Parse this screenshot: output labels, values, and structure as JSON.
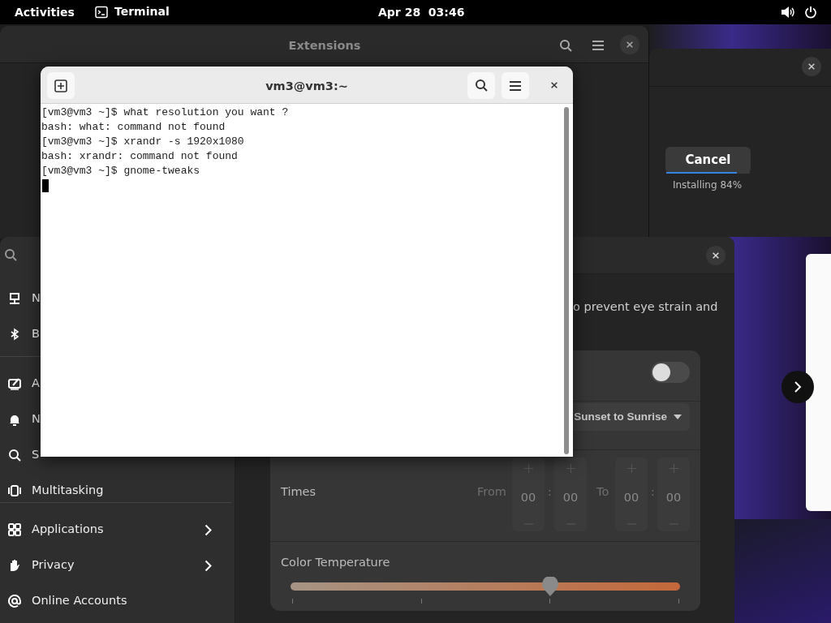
{
  "top_bar": {
    "activities": "Activities",
    "app": "Terminal",
    "clock": "Apr 28  03:46"
  },
  "extensions_window": {
    "title": "Extensions"
  },
  "software_window": {
    "button": "Cancel",
    "level": 0.84,
    "status": "Installing 84%"
  },
  "settings_window": {
    "sidebar": {
      "groups": [
        [
          {
            "label": "N",
            "chevron": false
          },
          {
            "label": "B",
            "chevron": false
          }
        ],
        [
          {
            "label": "A",
            "chevron": false
          },
          {
            "label": "N",
            "chevron": false
          },
          {
            "label": "S",
            "chevron": false
          },
          {
            "label": "Multitasking",
            "chevron": false
          }
        ],
        [
          {
            "label": "Applications",
            "chevron": true
          },
          {
            "label": "Privacy",
            "chevron": true
          },
          {
            "label": "Online Accounts",
            "chevron": false
          }
        ]
      ]
    },
    "description": "o prevent eye strain and",
    "switch": {
      "on": false
    },
    "schedule": "Sunset to Sunrise",
    "times": {
      "label": "Times",
      "from": {
        "label": "From",
        "hours": "00",
        "separator": ":",
        "minutes": "00"
      },
      "to": {
        "label": "To",
        "hours": "00",
        "separator": ":",
        "minutes": "00"
      }
    },
    "color_temperature": {
      "label": "Color Temperature",
      "level": 0.667
    }
  },
  "terminal": {
    "title": "vm3@vm3:~",
    "lines": [
      "[vm3@vm3 ~]$ what resolution you want ?",
      "bash: what: command not found",
      "[vm3@vm3 ~]$ xrandr -s 1920x1080",
      "bash: xrandr: command not found",
      "[vm3@vm3 ~]$ gnome-tweaks"
    ]
  }
}
